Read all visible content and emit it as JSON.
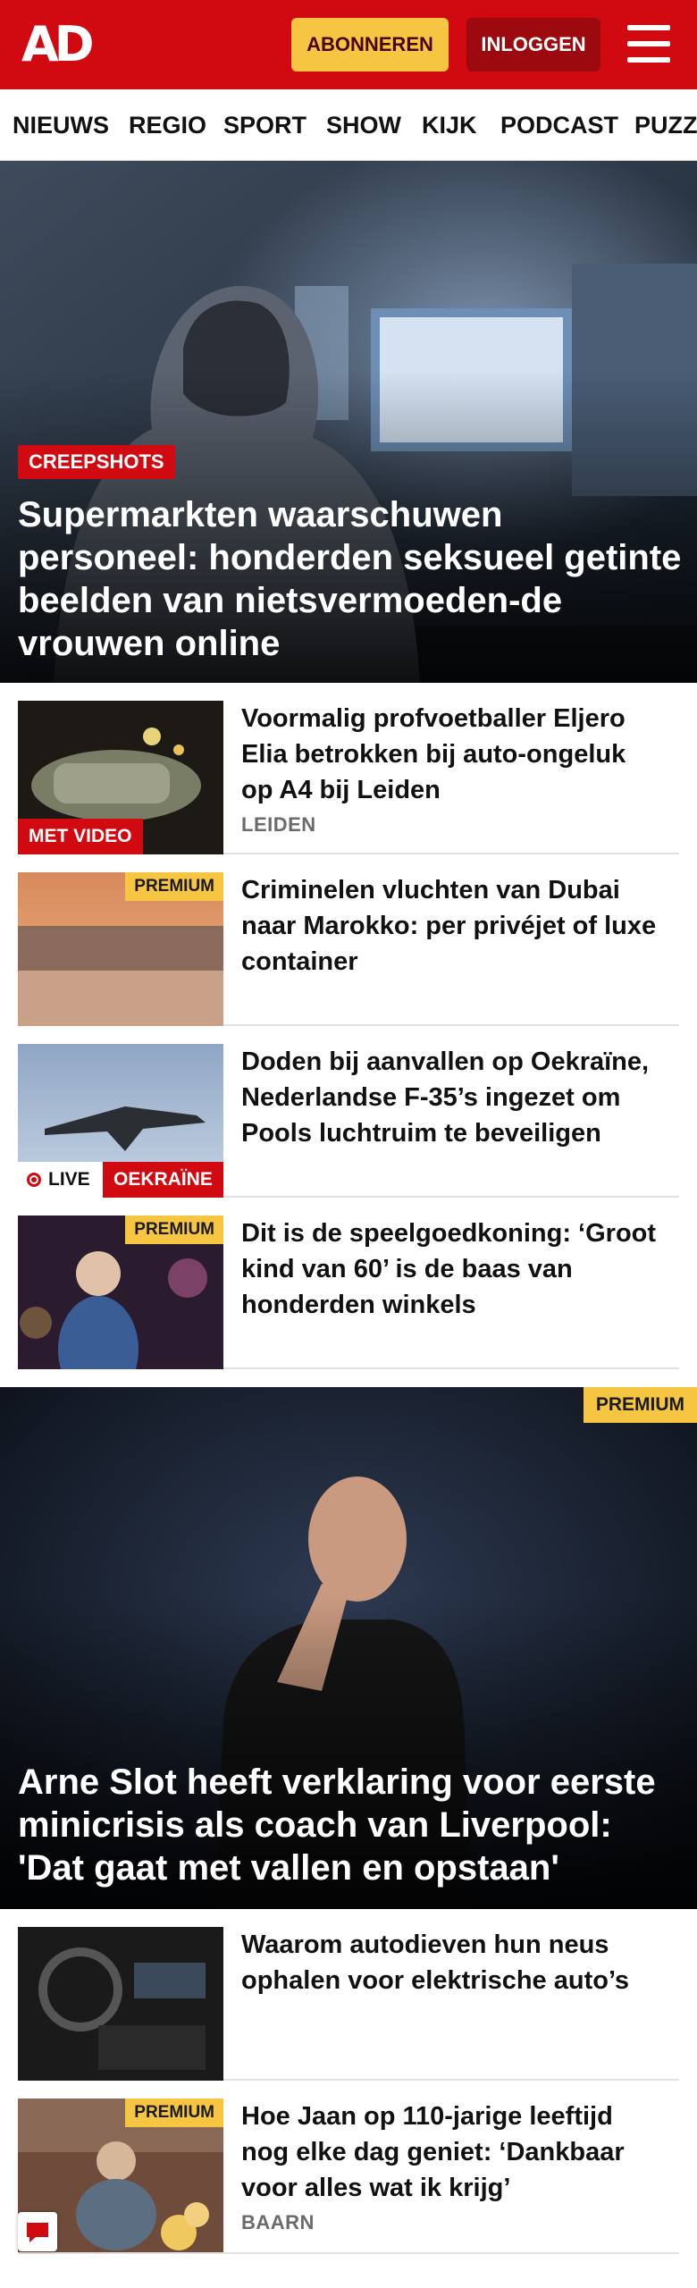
{
  "header": {
    "logo": "AD",
    "subscribe_label": "ABONNEREN",
    "login_label": "INLOGGEN",
    "menu_icon": "hamburger-menu-icon",
    "brand_color": "#d10a11",
    "accent_color": "#f6c642"
  },
  "nav": {
    "items": [
      "NIEUWS",
      "REGIO",
      "SPORT",
      "SHOW",
      "KIJK",
      "PODCAST",
      "PUZZ"
    ]
  },
  "hero1": {
    "tag": "CREEPSHOTS",
    "title": "Supermarkten waarschuwen personeel: honderden seksueel getinte beelden van nietsvermoeden-de vrouwen online"
  },
  "list1": [
    {
      "title": "Voormalig profvoetballer Eljero Elia betrokken bij auto-ongeluk op A4 bij Leiden",
      "location": "LEIDEN",
      "tag": "MET VIDEO"
    },
    {
      "title": "Criminelen vluchten van Dubai naar Marokko: per privéjet of luxe container",
      "badge": "PREMIUM"
    },
    {
      "title": "Doden bij aanvallen op Oekraïne, Nederlandse F-35’s ingezet om Pools luchtruim te beveiligen",
      "live": "LIVE",
      "tag": "OEKRAÏNE"
    },
    {
      "title": "Dit is de speelgoedkoning: ‘Groot kind van 60’ is de baas van honderden winkels",
      "badge": "PREMIUM"
    }
  ],
  "hero2": {
    "badge": "PREMIUM",
    "title": "Arne Slot heeft verklaring voor eerste minicrisis als coach van Liverpool: 'Dat gaat met vallen en opstaan'"
  },
  "list2": [
    {
      "title": "Waarom autodieven hun neus ophalen voor elektrische auto’s"
    },
    {
      "title": "Hoe Jaan op 110-jarige leeftijd nog elke dag geniet: ‘Dankbaar voor alles wat ik krijg’",
      "location": "BAARN",
      "badge": "PREMIUM"
    }
  ],
  "floating": {
    "icon": "comment-icon"
  }
}
